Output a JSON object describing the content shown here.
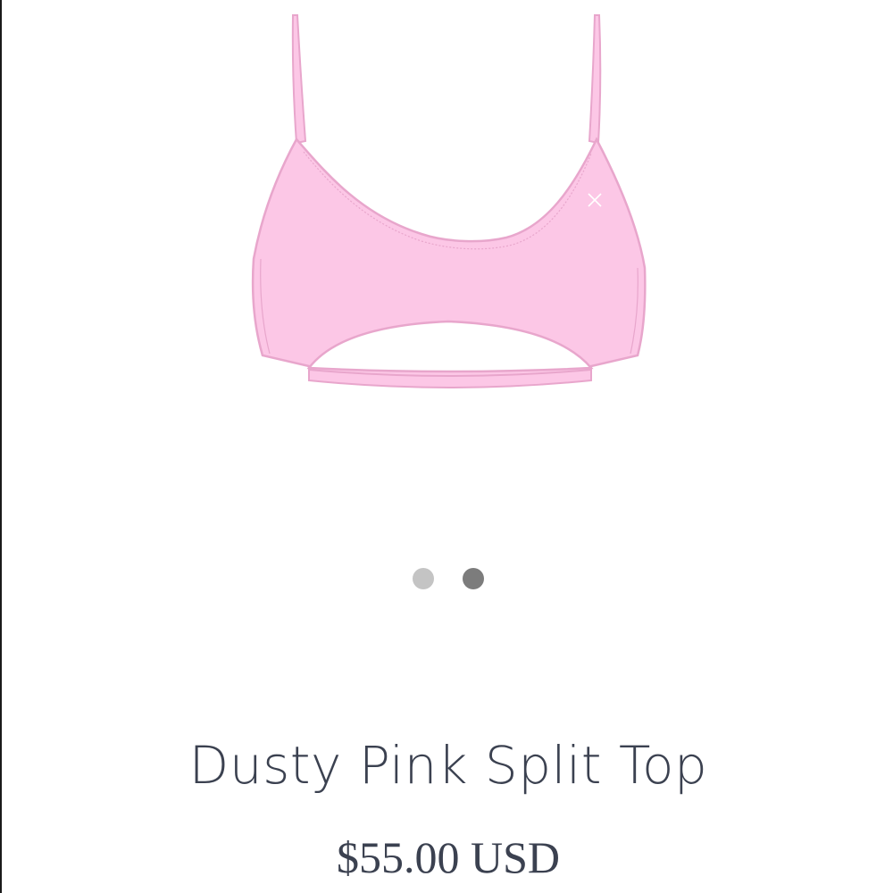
{
  "product": {
    "title": "Dusty Pink Split Top",
    "price": "$55.00 USD",
    "image": {
      "fill_color": "#fcc7e6",
      "outline_color": "#e8a6cc"
    }
  },
  "carousel": {
    "dots": [
      {
        "state": "inactive",
        "color": "#c4c4c4"
      },
      {
        "state": "active",
        "color": "#7c7c7c"
      }
    ]
  }
}
